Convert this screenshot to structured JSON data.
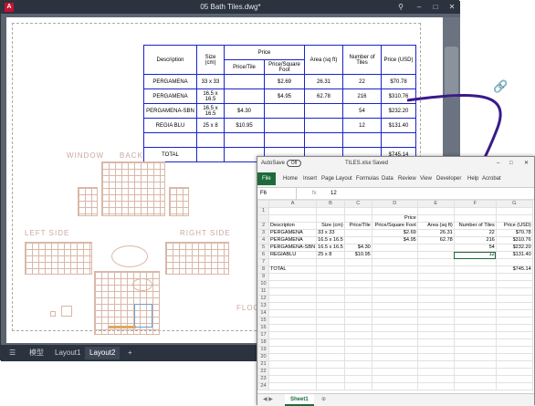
{
  "autocad": {
    "logo": "A",
    "title": "05 Bath Tiles.dwg*",
    "pin_icon": "pin-icon",
    "minimize": "–",
    "maximize": "□",
    "close": "✕",
    "bottom_tabs": [
      "Model",
      "Layout1",
      "Layout2"
    ],
    "model_tab_label": "模型",
    "add_tab": "+",
    "menu_icon": "☰",
    "plan_labels": {
      "window": "WINDOW",
      "back": "BACK",
      "left": "LEFT SIDE",
      "right": "RIGHT SIDE",
      "floor": "FLOO"
    }
  },
  "cad_table": {
    "headers": [
      "Description",
      "Size (cm)",
      "Price",
      "Area (sq ft)",
      "Number of Tiles",
      "Price (USD)"
    ],
    "subheaders": [
      "Price/Tile",
      "Price/Square Foot"
    ],
    "rows": [
      [
        "PERGAMENA",
        "33 x 33",
        "",
        "$2.69",
        "26.31",
        "22",
        "$70.78"
      ],
      [
        "PERGAMENA",
        "16.5 x 16.5",
        "",
        "$4.95",
        "62.78",
        "216",
        "$310.76"
      ],
      [
        "PERGAMENA-SBN",
        "16.5 x 16.5",
        "$4.30",
        "",
        "",
        "54",
        "$232.20"
      ],
      [
        "REGIA BLU",
        "25 x 8",
        "$10.95",
        "",
        "",
        "12",
        "$131.40"
      ],
      [
        "",
        "",
        "",
        "",
        "",
        "",
        ""
      ],
      [
        "TOTAL",
        "",
        "",
        "",
        "",
        "",
        "$745.14"
      ]
    ]
  },
  "excel": {
    "autosave_label": "AutoSave",
    "autosave_state": "Off",
    "filename": "TILES.xlsx",
    "saved_status": "Saved",
    "ribbon": [
      "File",
      "Home",
      "Insert",
      "Page Layout",
      "Formulas",
      "Data",
      "Review",
      "View",
      "Developer",
      "Help",
      "Acrobat"
    ],
    "name_box": "F6",
    "formula_value": "12",
    "columns": [
      "A",
      "B",
      "C",
      "D",
      "E",
      "F",
      "G"
    ],
    "rows": [
      [
        "",
        "",
        "",
        "",
        "",
        "",
        ""
      ],
      [
        "",
        "",
        "",
        "Price",
        "",
        "",
        ""
      ],
      [
        "Descripton",
        "Size (cm)",
        "Price/Tile",
        "Price/Square Foot",
        "Area (sq ft)",
        "Number of Tiles",
        "Price (USD)"
      ],
      [
        "PERGAMENA",
        "33 x 33",
        "",
        "$2.69",
        "26.31",
        "22",
        "$70.78"
      ],
      [
        "PERGAMENA",
        "16.5 x 16.5",
        "",
        "$4.95",
        "62.78",
        "216",
        "$310.76"
      ],
      [
        "PERGAMENA-SBN",
        "16.5 x 16.5",
        "$4.30",
        "",
        "",
        "54",
        "$232.20"
      ],
      [
        "REGIABLU",
        "25 x 8",
        "$10.95",
        "",
        "",
        "12",
        "$131.40"
      ],
      [
        "",
        "",
        "",
        "",
        "",
        "",
        ""
      ],
      [
        "TOTAL",
        "",
        "",
        "",
        "",
        "",
        "$745.14"
      ]
    ],
    "sheet_tab": "Sheet1"
  },
  "colors": {
    "cad_table_border": "#1a24c8",
    "excel_green": "#1d6b3a",
    "arrow": "#3a1a8a"
  }
}
